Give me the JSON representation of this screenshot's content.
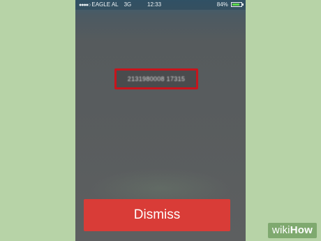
{
  "status_bar": {
    "signal_icon": "signal-dots-icon",
    "carrier": "EAGLE AL",
    "network": "3G",
    "time": "12:33",
    "battery_percent": "84%",
    "battery_level": 0.84,
    "battery_icon": "battery-icon"
  },
  "call": {
    "number": "2131980008 17315"
  },
  "dismiss_label": "Dismiss",
  "watermark": {
    "wiki": "wiki",
    "how": "How"
  },
  "colors": {
    "background": "#b7d3a7",
    "highlight_border": "#c8141c",
    "dismiss": "#d93c37",
    "battery": "#5ed84b"
  }
}
